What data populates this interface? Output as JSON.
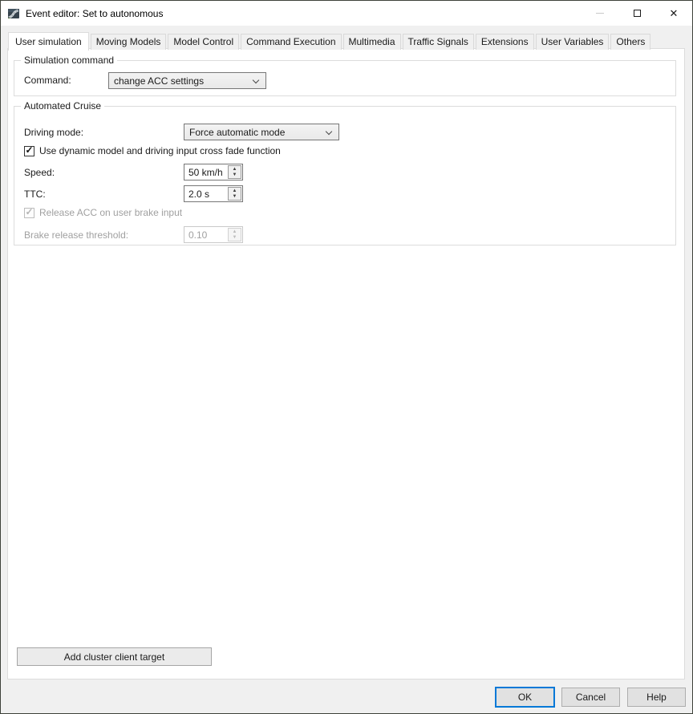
{
  "window": {
    "title": "Event editor: Set to autonomous"
  },
  "icons": {
    "check": "✓",
    "spin_up": "▲",
    "spin_down": "▼",
    "close": "✕"
  },
  "tabs": [
    {
      "label": "User simulation",
      "active": true
    },
    {
      "label": "Moving Models",
      "active": false
    },
    {
      "label": "Model Control",
      "active": false
    },
    {
      "label": "Command Execution",
      "active": false
    },
    {
      "label": "Multimedia",
      "active": false
    },
    {
      "label": "Traffic Signals",
      "active": false
    },
    {
      "label": "Extensions",
      "active": false
    },
    {
      "label": "User Variables",
      "active": false
    },
    {
      "label": "Others",
      "active": false
    }
  ],
  "simulation_command": {
    "group_label": "Simulation command",
    "command_label": "Command:",
    "command_value": "change ACC settings"
  },
  "automated_cruise": {
    "group_label": "Automated Cruise",
    "driving_mode_label": "Driving mode:",
    "driving_mode_value": "Force automatic mode",
    "crossfade_label": "Use dynamic model and driving input cross fade function",
    "crossfade_checked": true,
    "speed_label": "Speed:",
    "speed_value": "50 km/h",
    "ttc_label": "TTC:",
    "ttc_value": "2.0 s",
    "release_acc_label": "Release ACC on user brake input",
    "release_acc_checked": true,
    "release_acc_enabled": false,
    "brake_threshold_label": "Brake release threshold:",
    "brake_threshold_value": "0.10",
    "brake_threshold_enabled": false
  },
  "footer": {
    "add_cluster_label": "Add cluster client target",
    "ok_label": "OK",
    "cancel_label": "Cancel",
    "help_label": "Help"
  },
  "colors": {
    "accent_focus": "#0078d7",
    "dialog_bg": "#f0f0f0",
    "titlebar_bg": "#ffffff",
    "disabled_text": "#a0a0a0",
    "window_border": "#3e423a"
  }
}
